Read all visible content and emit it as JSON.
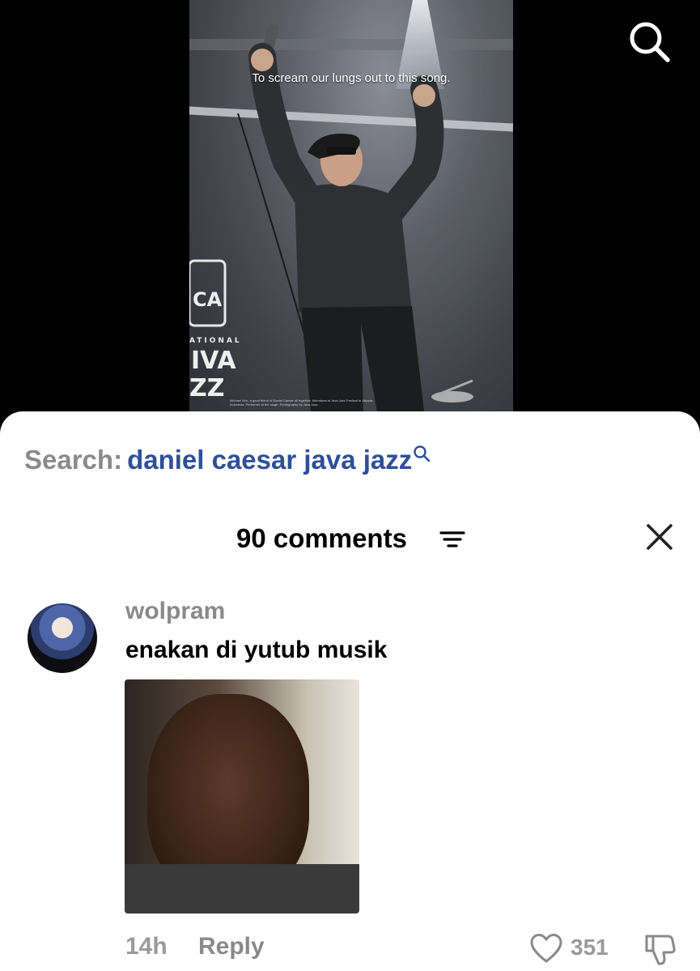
{
  "video": {
    "caption": "To scream our lungs out to this song.",
    "sign_fragments": [
      "CA",
      "ATIONAL",
      "IVA",
      "ZZ"
    ],
    "fineprint": "Michael Vick, a good friend of Daniel Caesar all together. Attendees at Java Jazz Festival in Jakarta, Indonesia. Performer at the stage. Photography by Java Jazz.",
    "search_icon": "search-icon"
  },
  "comments_sheet": {
    "search_prefix": "Search:",
    "search_query": "daniel caesar java jazz",
    "title": "90 comments",
    "sort_icon": "sort-lines-icon",
    "close_icon": "close-x-icon",
    "comment": {
      "username": "wolpram",
      "text": "enakan di yutub musik",
      "gif_description": "crying-man-gif",
      "time": "14h",
      "reply_label": "Reply",
      "likes": "351",
      "like_icon": "heart-icon",
      "dislike_icon": "thumbs-down-icon"
    }
  },
  "colors": {
    "search_query": "#2f4f9a",
    "muted_text": "#8a8a8a",
    "sheet_bg": "#ffffff",
    "page_bg": "#000000"
  }
}
